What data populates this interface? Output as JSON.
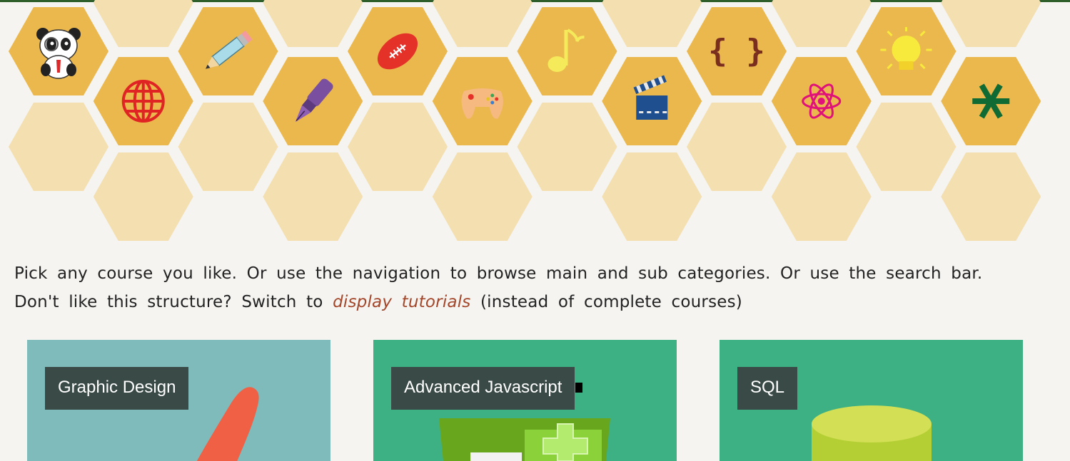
{
  "colors": {
    "hex_active": "#ebb84e",
    "hex_inactive": "#f4dfb0",
    "link": "#a3462a",
    "card_graphic": "#7fbbbb",
    "card_green": "#3eb184",
    "label_bg": "#3a4b47"
  },
  "categories": [
    {
      "icon": "panda-icon"
    },
    {
      "icon": "globe-icon"
    },
    {
      "icon": "pencil-icon"
    },
    {
      "icon": "fountain-pen-icon"
    },
    {
      "icon": "football-icon"
    },
    {
      "icon": "gamepad-icon"
    },
    {
      "icon": "music-note-icon"
    },
    {
      "icon": "clapperboard-icon"
    },
    {
      "icon": "curly-braces-icon"
    },
    {
      "icon": "atom-icon"
    },
    {
      "icon": "lightbulb-icon"
    },
    {
      "icon": "asterisk-icon"
    }
  ],
  "intro": {
    "line1": "Pick any course you like. Or use the navigation to browse main and sub categories. Or use the search bar.",
    "line2_before": "Don't like this structure? Switch to ",
    "line2_link": "display tutorials",
    "line2_after": " (instead of complete courses)"
  },
  "courses": [
    {
      "title": "Graphic Design",
      "image_icon": "brush-icon"
    },
    {
      "title": "Advanced Javascript",
      "image_icon": "js-file-icon"
    },
    {
      "title": "SQL",
      "image_icon": "database-icon"
    }
  ]
}
